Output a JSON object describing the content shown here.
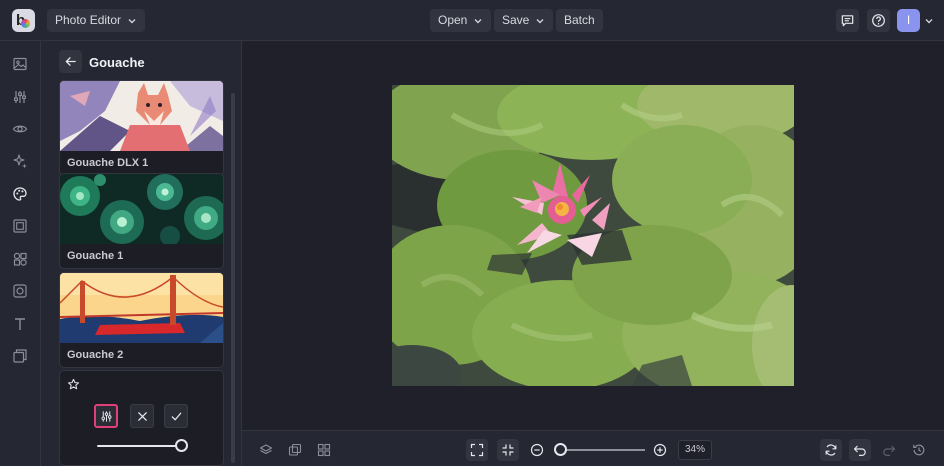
{
  "app": {
    "menu_label": "Photo Editor"
  },
  "toolbar": {
    "open_label": "Open",
    "save_label": "Save",
    "batch_label": "Batch",
    "avatar_initial": "I"
  },
  "rail": {
    "items": [
      {
        "icon": "image-icon"
      },
      {
        "icon": "adjust-sliders-icon"
      },
      {
        "icon": "eye-icon"
      },
      {
        "icon": "sparkle-effects-icon"
      },
      {
        "icon": "artsy-palette-icon"
      },
      {
        "icon": "frame-icon"
      },
      {
        "icon": "graphics-shapes-icon"
      },
      {
        "icon": "overlay-icon"
      },
      {
        "icon": "text-icon"
      },
      {
        "icon": "layers-icon"
      }
    ]
  },
  "panel": {
    "title": "Gouache",
    "cards": [
      {
        "label": "Gouache DLX 1",
        "thumb": "fox-thumbnail"
      },
      {
        "label": "Gouache 1",
        "thumb": "succulents-thumbnail"
      },
      {
        "label": "Gouache 2",
        "thumb": "golden-gate-bridge-thumbnail"
      }
    ]
  },
  "adjust": {
    "intensity_level": 1.0
  },
  "bottom": {
    "zoom_level": "34%"
  },
  "colors": {
    "accent": "#e23f7a",
    "background": "#1f2029",
    "surface": "#252732",
    "avatar": "#8a93ee"
  }
}
